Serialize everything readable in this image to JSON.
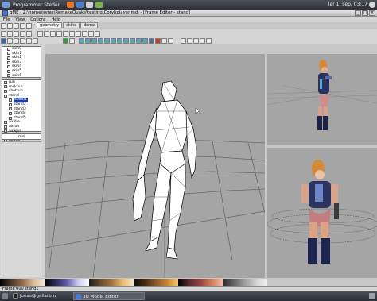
{
  "top_panel": {
    "menu_label": "Programmer  Steder",
    "clock": "lør 1. sep, 03:17"
  },
  "window": {
    "title": "qME - Z:\\home\\jonas\\RemakeQuake\\testing\\Coryl\\player.mdl - [Frame Editor - stand]",
    "minimize_glyph": "_",
    "maximize_glyph": "□",
    "close_glyph": "×"
  },
  "menubar": {
    "items": [
      "File",
      "View",
      "Options",
      "Help"
    ]
  },
  "tabs": [
    "geometry",
    "skins",
    "demo"
  ],
  "skins_list": [
    "skin0",
    "skin1",
    "skin2",
    "skin3",
    "skin4",
    "skin5",
    "skin6"
  ],
  "frame_tree": {
    "items": [
      {
        "label": "run",
        "depth": 0,
        "selected": false
      },
      {
        "label": "rockrun",
        "depth": 0,
        "selected": false
      },
      {
        "label": "shotrun",
        "depth": 0,
        "selected": false
      },
      {
        "label": "stand",
        "depth": 0,
        "selected": false
      },
      {
        "label": "stand1",
        "depth": 1,
        "selected": true
      },
      {
        "label": "stand2",
        "depth": 1,
        "selected": false
      },
      {
        "label": "stand3",
        "depth": 1,
        "selected": false
      },
      {
        "label": "stand4",
        "depth": 1,
        "selected": false
      },
      {
        "label": "stand5",
        "depth": 1,
        "selected": false
      },
      {
        "label": "axidle",
        "depth": 0,
        "selected": false
      },
      {
        "label": "axrun",
        "depth": 0,
        "selected": false
      },
      {
        "label": "axwpn",
        "depth": 0,
        "selected": false
      },
      {
        "label": "pain",
        "depth": 0,
        "selected": false
      },
      {
        "label": "axdeth",
        "depth": 0,
        "selected": false
      },
      {
        "label": "deth",
        "depth": 0,
        "selected": false
      }
    ]
  },
  "origin_field": "root",
  "statusbar": {
    "text": "Frame 000 stand1"
  },
  "taskbar": {
    "tasks": [
      "jonas@gallarbnz",
      "3D Model Editor"
    ]
  },
  "colors": {
    "panel": "#d4d4d4",
    "viewport_bg": "#a5a5a5",
    "selection": "#1b3ea8",
    "desktop_bar": "#3a3d45"
  },
  "icons": [
    "app-icon",
    "folder-icon",
    "save-icon",
    "undo-icon",
    "zoom-icon",
    "rotate-icon",
    "grid-icon",
    "cursor-icon"
  ]
}
